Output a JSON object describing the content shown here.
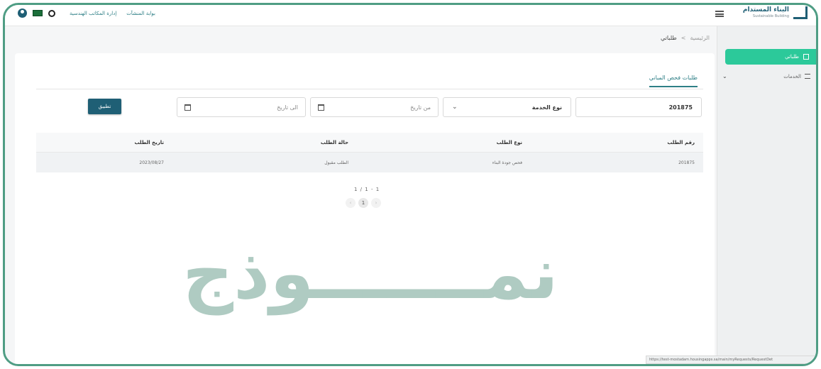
{
  "topbar": {
    "brand_title": "البناء المستدام",
    "brand_subtitle": "Sustainable Building",
    "link_engineering": "إدارة المكاتب الهندسية",
    "link_buildings": "بوابة المنشآت"
  },
  "sidebar": {
    "active_label": "طلباتي",
    "services_label": "الخدمات"
  },
  "breadcrumb": {
    "home": "الرئيسية",
    "separator": ">",
    "current": "طلباتي"
  },
  "tab": {
    "title": "طلبات فحص المباني"
  },
  "filters": {
    "request_number_value": "201875",
    "service_type_value": "نوع الخدمة",
    "from_date_placeholder": "من تاريخ",
    "to_date_placeholder": "الى تاريخ",
    "apply_label": "تطبيق"
  },
  "table": {
    "headers": [
      "رقم الطلب",
      "نوع الطلب",
      "حالة الطلب",
      "تاريخ الطلب"
    ],
    "rows": [
      [
        "201875",
        "فحص جودة البناء",
        "الطلب مقبول",
        "2023/08/27"
      ]
    ]
  },
  "pagination": {
    "info": "1 / 1 - 1",
    "current_page": "1",
    "prev": "‹",
    "next": "›"
  },
  "watermark": "نمـــــــوذج",
  "statusbar_url": "https://test-mostadam.housingapps.sa/main/myRequests/RequestDet",
  "colors": {
    "accent": "#2cc99a",
    "primary": "#1f5f75",
    "frame": "#4f9d84"
  }
}
